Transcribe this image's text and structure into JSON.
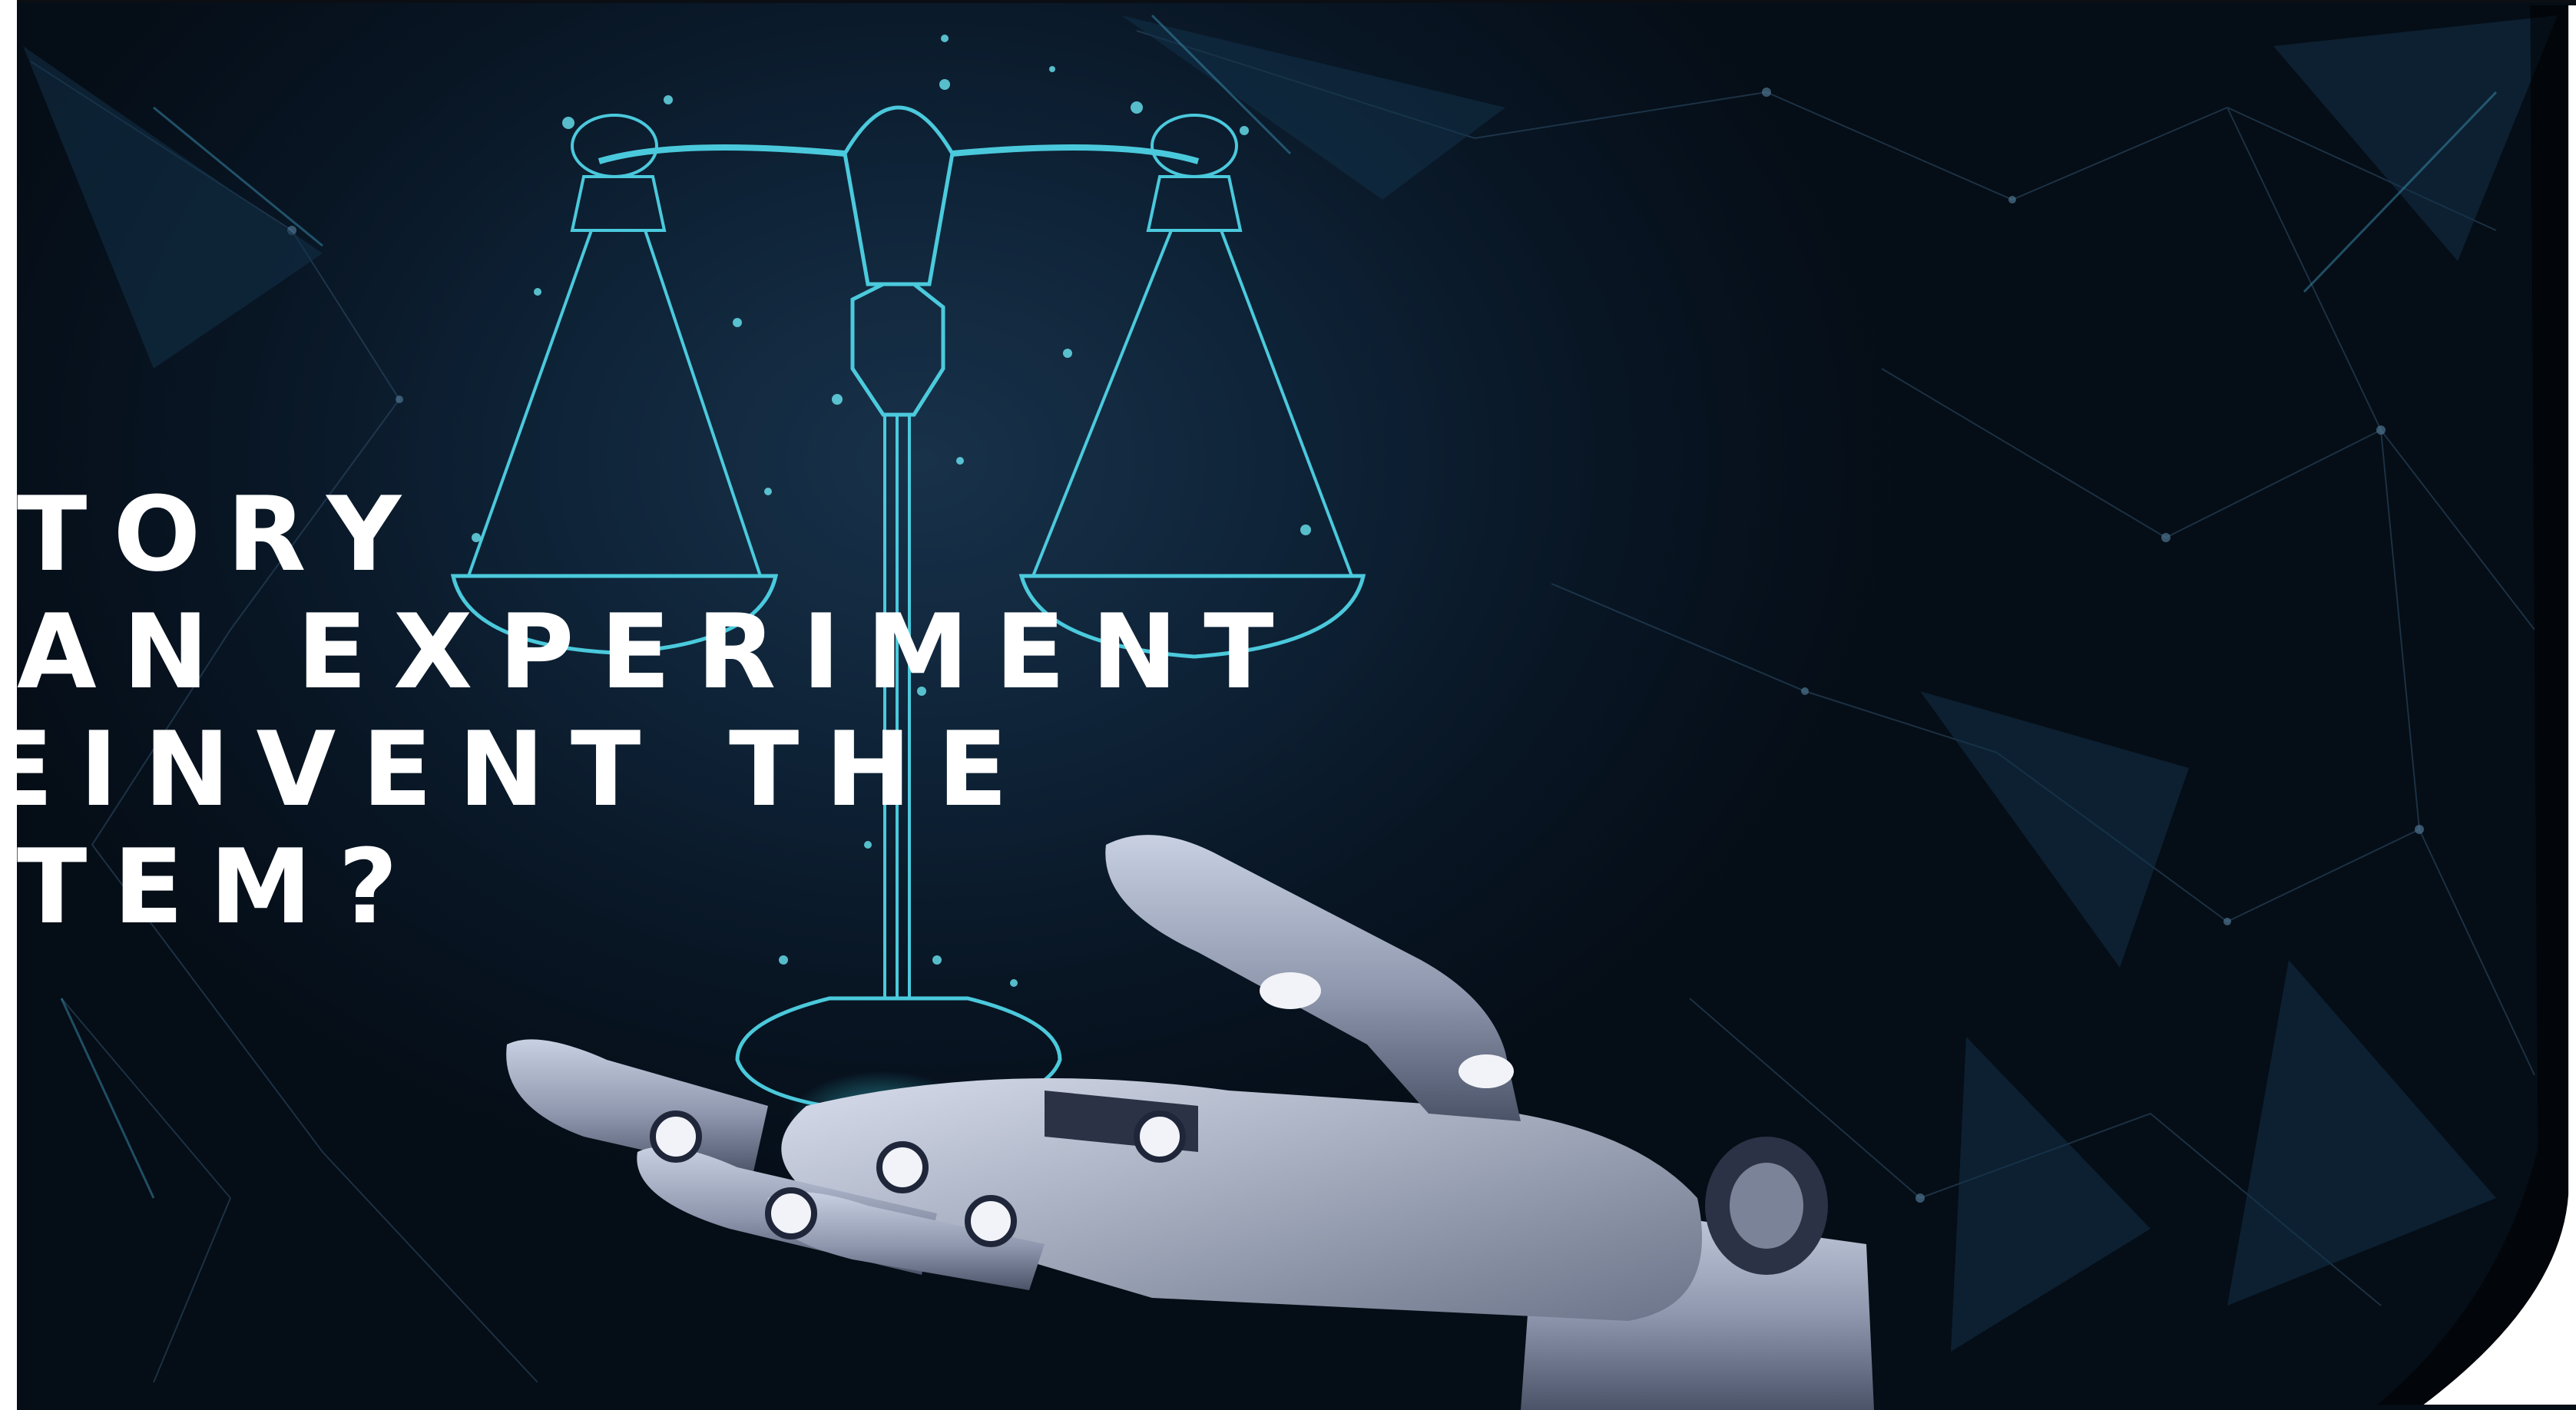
{
  "headline": {
    "lines": [
      "TORY",
      "AN EXPERIMENT",
      "EINVENT THE",
      "TEM?"
    ]
  },
  "illustration": {
    "scale_icon": "justice-scale-icon",
    "hand_icon": "robot-hand-icon"
  },
  "colors": {
    "background": "#0e2236",
    "glow": "#3fd6e8",
    "text": "#ffffff",
    "robot": "#aab3c8"
  }
}
